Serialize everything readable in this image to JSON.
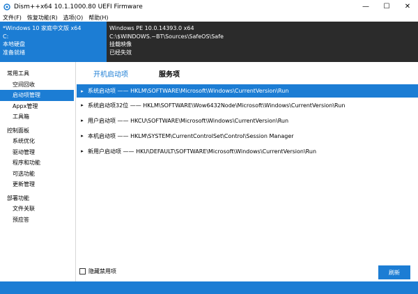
{
  "window": {
    "title": "Dism++x64 10.1.1000.80 UEFI Firmware",
    "minimize": "—",
    "maximize": "☐",
    "close": "✕"
  },
  "menu": [
    "文件(F)",
    "恢复功能(R)",
    "选项(O)",
    "帮助(H)"
  ],
  "info": {
    "left": [
      "*Windows 10 家庭中文版 x64",
      "C:",
      "本地硬盘",
      "准备就绪"
    ],
    "right": [
      "Windows PE 10.0.14393.0 x64",
      "C:\\$WINDOWS.~BT\\Sources\\SafeOS\\Safe",
      "挂载映像",
      "已经失效"
    ]
  },
  "sidebar": {
    "categories": [
      {
        "label": "常用工具",
        "items": [
          "空间回收",
          "启动项管理",
          "Appx管理",
          "工具箱"
        ]
      },
      {
        "label": "控制面板",
        "items": [
          "系统优化",
          "驱动管理",
          "程序和功能",
          "可选功能",
          "更新管理"
        ]
      },
      {
        "label": "部署功能",
        "items": [
          "文件关联",
          "预应答"
        ]
      }
    ],
    "active_item": "启动项管理"
  },
  "tabs": [
    "开机启动项",
    "服务项"
  ],
  "rows": [
    {
      "label": "系统启动项",
      "path": "HKLM\\SOFTWARE\\Microsoft\\Windows\\CurrentVersion\\Run"
    },
    {
      "label": "系统启动项32位",
      "path": "HKLM\\SOFTWARE\\Wow6432Node\\Microsoft\\Windows\\CurrentVersion\\Run"
    },
    {
      "label": "用户启动项",
      "path": "HKCU\\SOFTWARE\\Microsoft\\Windows\\CurrentVersion\\Run"
    },
    {
      "label": "本机启动项",
      "path": "HKLM\\SYSTEM\\CurrentControlSet\\Control\\Session Manager"
    },
    {
      "label": "新用户启动项",
      "path": "HKU\\DEFAULT\\SOFTWARE\\Microsoft\\Windows\\CurrentVersion\\Run"
    }
  ],
  "separator": "——",
  "bottom": {
    "hide_disabled_label": "隐藏禁用项",
    "refresh_label": "刷新"
  },
  "colors": {
    "accent": "#1c7dd4",
    "dark_panel": "#2b2b2b"
  }
}
